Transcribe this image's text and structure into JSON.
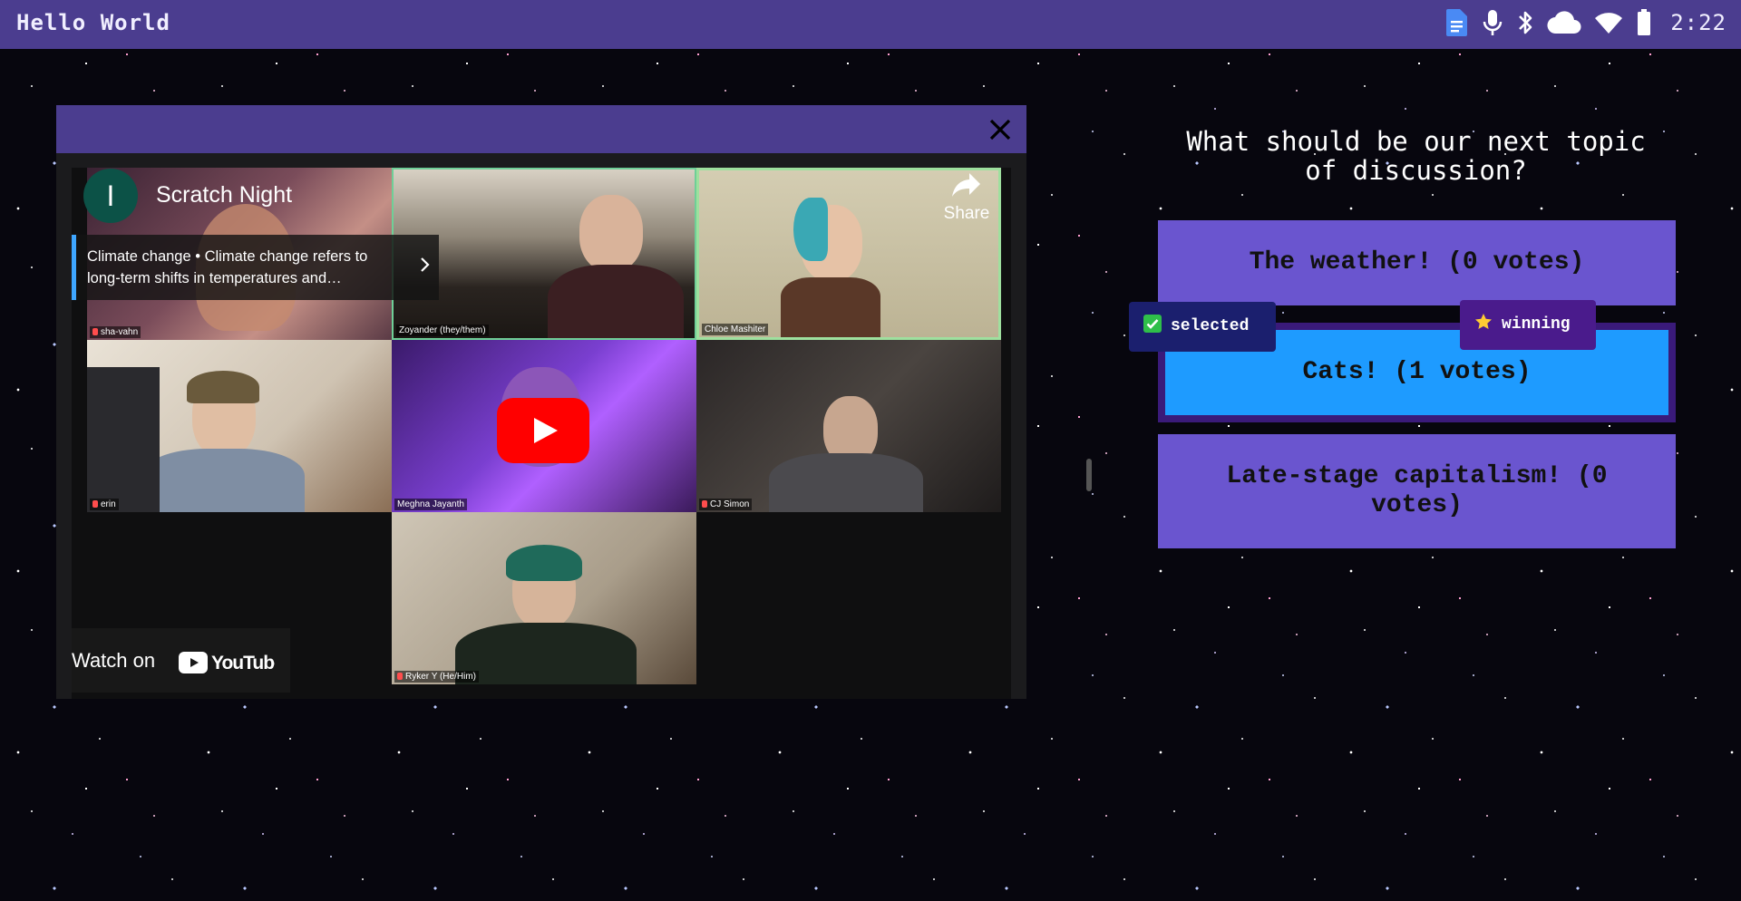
{
  "topbar": {
    "app_title": "Hello World",
    "status_icons": [
      "document-icon",
      "microphone-icon",
      "bluetooth-icon",
      "cloud-icon",
      "wifi-icon",
      "battery-icon"
    ],
    "time": "2:22"
  },
  "video": {
    "channel_initial": "I",
    "title": "Scratch Night",
    "share_label": "Share",
    "card_text": "Climate change • Climate change refers to long-term shifts in temperatures and…",
    "watch_on_label": "Watch on",
    "youtube_wordmark": "YouTube",
    "participants": [
      {
        "name": "sha-vahn"
      },
      {
        "name": "Zoyander (they/them)"
      },
      {
        "name": "Chloe Mashiter"
      },
      {
        "name": "erin"
      },
      {
        "name": "Meghna Jayanth"
      },
      {
        "name": "CJ Simon"
      },
      {
        "name": "Ryker Y (He/Him)"
      }
    ]
  },
  "poll": {
    "question": "What should be our next topic of discussion?",
    "options": [
      {
        "label": "The weather! (0 votes)"
      },
      {
        "label": "Cats! (1 votes)"
      },
      {
        "label": "Late-stage capitalism! (0 votes)"
      }
    ],
    "selected_tag": "selected",
    "winning_tag": "winning"
  },
  "colors": {
    "bar": "#4b3d8f",
    "option": "#6a55cf",
    "selected_option": "#1e9bff",
    "selected_tag": "#1b1f6e",
    "winning_tag": "#4a1b8c",
    "youtube_red": "#ff0000"
  }
}
